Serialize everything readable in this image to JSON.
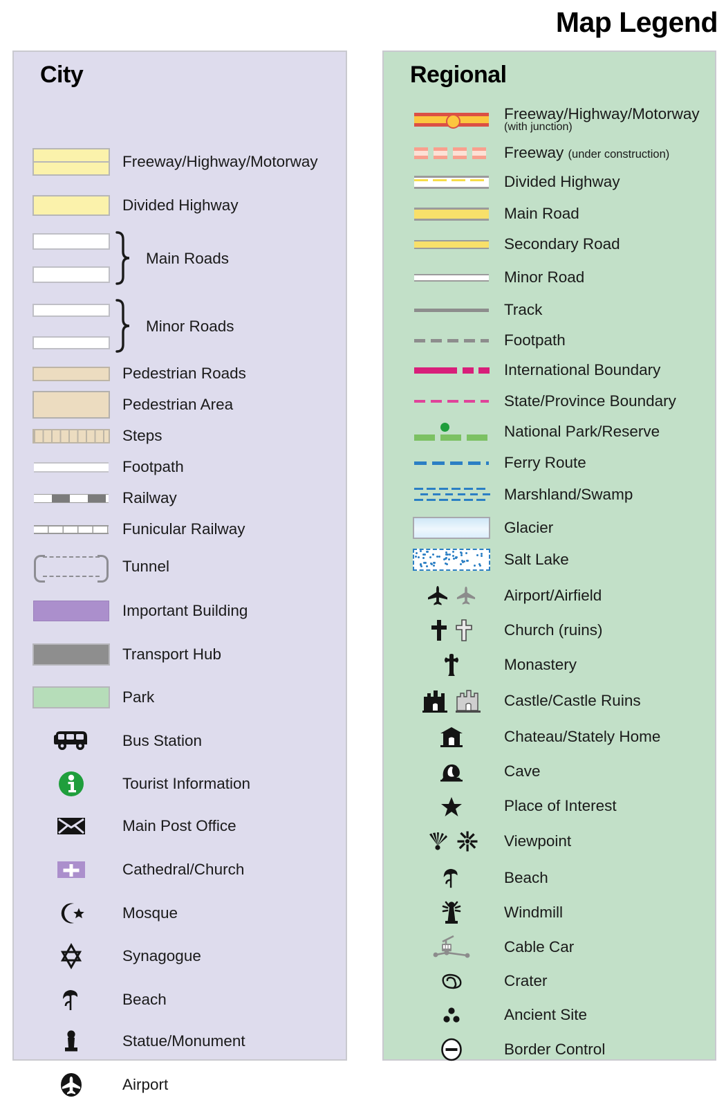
{
  "title": "Map Legend",
  "city": {
    "heading": "City",
    "bg_color": "#dedced",
    "items": [
      {
        "label": "Freeway/Highway/Motorway",
        "symbol": "freeway-double-band"
      },
      {
        "label": "Divided Highway",
        "symbol": "divided-highway-band"
      },
      {
        "label": "Main Roads",
        "symbol": "main-roads-pair-braced"
      },
      {
        "label": "Minor Roads",
        "symbol": "minor-roads-pair-braced"
      },
      {
        "label": "Pedestrian Roads",
        "symbol": "pedestrian-road-band"
      },
      {
        "label": "Pedestrian Area",
        "symbol": "pedestrian-area-block"
      },
      {
        "label": "Steps",
        "symbol": "steps-hatched-band"
      },
      {
        "label": "Footpath",
        "symbol": "footpath-thin-line"
      },
      {
        "label": "Railway",
        "symbol": "railway-dashed-line"
      },
      {
        "label": "Funicular Railway",
        "symbol": "funicular-ticked-line"
      },
      {
        "label": "Tunnel",
        "symbol": "tunnel-bracket-dashed"
      },
      {
        "label": "Important Building",
        "symbol": "important-building-swatch"
      },
      {
        "label": "Transport Hub",
        "symbol": "transport-hub-swatch"
      },
      {
        "label": "Park",
        "symbol": "park-swatch"
      },
      {
        "label": "Bus Station",
        "symbol": "bus-icon"
      },
      {
        "label": "Tourist Information",
        "symbol": "information-icon"
      },
      {
        "label": "Main Post Office",
        "symbol": "envelope-icon"
      },
      {
        "label": "Cathedral/Church",
        "symbol": "church-cross-block-icon"
      },
      {
        "label": "Mosque",
        "symbol": "star-and-crescent-icon"
      },
      {
        "label": "Synagogue",
        "symbol": "star-of-david-icon"
      },
      {
        "label": "Beach",
        "symbol": "beach-parasol-icon"
      },
      {
        "label": "Statue/Monument",
        "symbol": "statue-icon"
      },
      {
        "label": "Airport",
        "symbol": "airport-circle-icon"
      }
    ]
  },
  "regional": {
    "heading": "Regional",
    "bg_color": "#c2e0c8",
    "items": [
      {
        "label": "Freeway/Highway/Motorway",
        "sublabel": "(with junction)",
        "sub_style": "block",
        "symbol": "freeway-with-junction-line"
      },
      {
        "label": "Freeway",
        "sublabel": "(under construction)",
        "sub_style": "inline",
        "symbol": "freeway-under-construction-line"
      },
      {
        "label": "Divided Highway",
        "symbol": "divided-highway-line"
      },
      {
        "label": "Main Road",
        "symbol": "main-road-line"
      },
      {
        "label": "Secondary Road",
        "symbol": "secondary-road-line"
      },
      {
        "label": "Minor Road",
        "symbol": "minor-road-line"
      },
      {
        "label": "Track",
        "symbol": "track-line"
      },
      {
        "label": "Footpath",
        "symbol": "footpath-dashed-line"
      },
      {
        "label": "International Boundary",
        "symbol": "international-boundary-line"
      },
      {
        "label": "State/Province Boundary",
        "symbol": "state-boundary-line"
      },
      {
        "label": "National Park/Reserve",
        "symbol": "national-park-line"
      },
      {
        "label": "Ferry Route",
        "symbol": "ferry-route-line"
      },
      {
        "label": "Marshland/Swamp",
        "symbol": "marshland-pattern"
      },
      {
        "label": "Glacier",
        "symbol": "glacier-swatch"
      },
      {
        "label": "Salt Lake",
        "symbol": "salt-lake-pattern"
      },
      {
        "label": "Airport/Airfield",
        "symbol": "airplane-pair-icon"
      },
      {
        "label": "Church (ruins)",
        "symbol": "church-cross-pair-icon"
      },
      {
        "label": "Monastery",
        "symbol": "monastery-cross-icon"
      },
      {
        "label": "Castle/Castle Ruins",
        "symbol": "castle-pair-icon"
      },
      {
        "label": "Chateau/Stately Home",
        "symbol": "chateau-icon"
      },
      {
        "label": "Cave",
        "symbol": "cave-icon"
      },
      {
        "label": "Place of Interest",
        "symbol": "star-icon"
      },
      {
        "label": "Viewpoint",
        "symbol": "viewpoint-pair-icon"
      },
      {
        "label": "Beach",
        "symbol": "beach-parasol-icon"
      },
      {
        "label": "Windmill",
        "symbol": "windmill-icon"
      },
      {
        "label": "Cable Car",
        "symbol": "cable-car-icon"
      },
      {
        "label": "Crater",
        "symbol": "crater-icon"
      },
      {
        "label": "Ancient Site",
        "symbol": "ancient-site-icon"
      },
      {
        "label": "Border Control",
        "symbol": "border-control-icon"
      }
    ]
  },
  "colors": {
    "freeway_yellow": "#fbf2ab",
    "road_white": "#ffffff",
    "pedestrian_tan": "#ecdcc0",
    "building_purple": "#ab8fcc",
    "hub_grey": "#8e8e8e",
    "park_green": "#b6ddb9",
    "regional_red": "#db5045",
    "regional_yellow": "#fcc63f",
    "boundary_magenta": "#d81f7a",
    "park_line_green": "#7cc163",
    "ferry_blue": "#2b7fc4",
    "info_green": "#1f9e3c"
  }
}
